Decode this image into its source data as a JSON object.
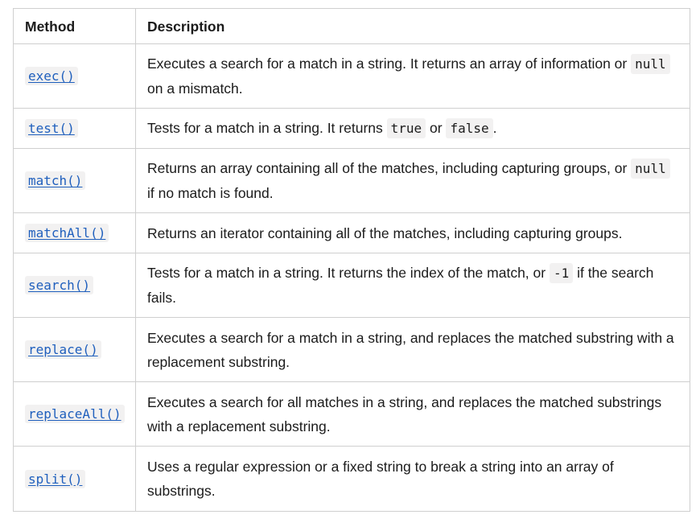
{
  "table": {
    "headers": {
      "method": "Method",
      "description": "Description"
    },
    "rows": [
      {
        "method": "exec()",
        "desc_before": "Executes a search for a match in a string. It returns an array of information or ",
        "code1": "null",
        "desc_mid": " on a mismatch.",
        "code2": "",
        "desc_after": ""
      },
      {
        "method": "test()",
        "desc_before": "Tests for a match in a string. It returns ",
        "code1": "true",
        "desc_mid": " or ",
        "code2": "false",
        "desc_after": "."
      },
      {
        "method": "match()",
        "desc_before": "Returns an array containing all of the matches, including capturing groups, or ",
        "code1": "null",
        "desc_mid": " if no match is found.",
        "code2": "",
        "desc_after": ""
      },
      {
        "method": "matchAll()",
        "desc_before": "Returns an iterator containing all of the matches, including capturing groups.",
        "code1": "",
        "desc_mid": "",
        "code2": "",
        "desc_after": ""
      },
      {
        "method": "search()",
        "desc_before": "Tests for a match in a string. It returns the index of the match, or ",
        "code1": "-1",
        "desc_mid": " if the search fails.",
        "code2": "",
        "desc_after": ""
      },
      {
        "method": "replace()",
        "desc_before": "Executes a search for a match in a string, and replaces the matched substring with a replacement substring.",
        "code1": "",
        "desc_mid": "",
        "code2": "",
        "desc_after": ""
      },
      {
        "method": "replaceAll()",
        "desc_before": "Executes a search for all matches in a string, and replaces the matched substrings with a replacement substring.",
        "code1": "",
        "desc_mid": "",
        "code2": "",
        "desc_after": ""
      },
      {
        "method": "split()",
        "desc_before": "Uses a regular expression or a fixed string to break a string into an array of substrings.",
        "code1": "",
        "desc_mid": "",
        "code2": "",
        "desc_after": ""
      }
    ]
  },
  "colors": {
    "link": "#1f5fbd",
    "code_bg": "#f2f1f1",
    "border": "#cfcfcf",
    "text": "#1b1b1b"
  }
}
